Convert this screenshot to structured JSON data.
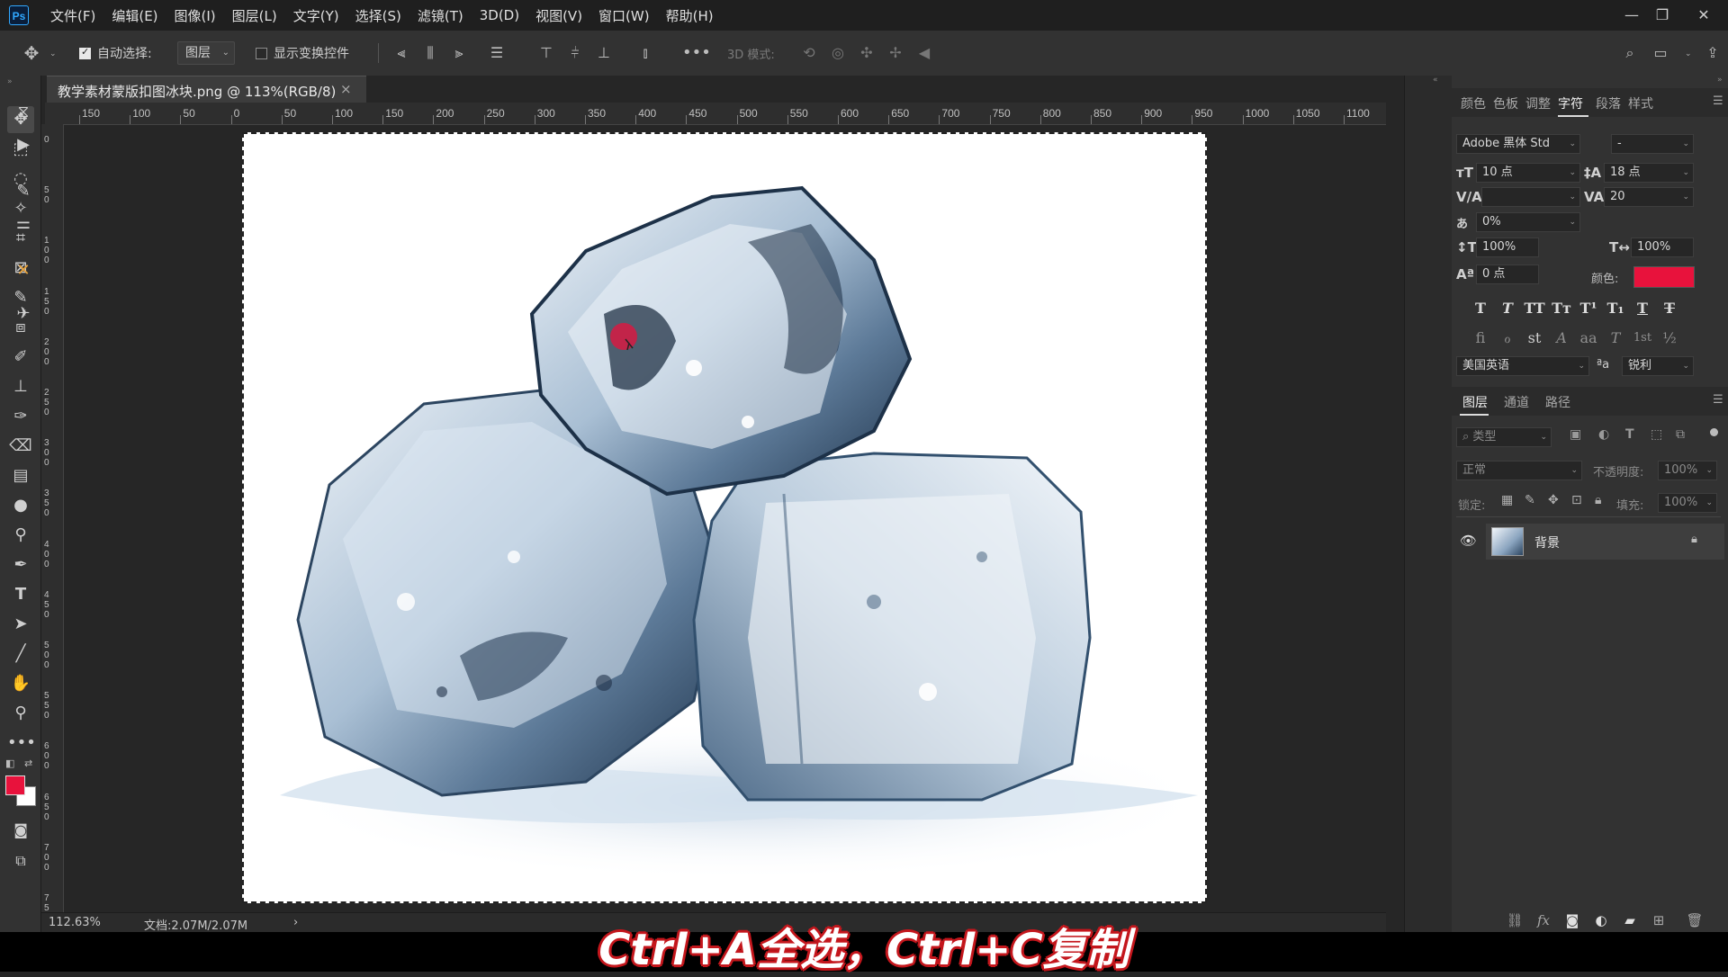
{
  "app": {
    "logo": "Ps"
  },
  "menu": [
    "文件(F)",
    "编辑(E)",
    "图像(I)",
    "图层(L)",
    "文字(Y)",
    "选择(S)",
    "滤镜(T)",
    "3D(D)",
    "视图(V)",
    "窗口(W)",
    "帮助(H)"
  ],
  "options_bar": {
    "auto_select_label": "自动选择:",
    "auto_select_checked": true,
    "target_dropdown": "图层",
    "show_transform_label": "显示变换控件",
    "show_transform_checked": false,
    "mode_3d_label": "3D 模式:"
  },
  "document": {
    "tab_title": "教学素材蒙版扣图冰块.png @ 113%(RGB/8)",
    "close": "×",
    "zoom": "112.63%",
    "doc_size": "文档:2.07M/2.07M",
    "status_arrow": "›"
  },
  "rulers": {
    "h_labels": [
      "150",
      "100",
      "50",
      "0",
      "50",
      "100",
      "150",
      "200",
      "250",
      "300",
      "350",
      "400",
      "450",
      "500",
      "550",
      "600",
      "650",
      "700",
      "750",
      "800",
      "850",
      "900",
      "950",
      "1000",
      "1050",
      "1100"
    ],
    "v_labels": [
      "0",
      "50",
      "100",
      "150",
      "200",
      "250",
      "300",
      "350",
      "400",
      "450",
      "500",
      "550",
      "600",
      "650",
      "700",
      "750"
    ]
  },
  "character_panel": {
    "tabs": [
      "颜色",
      "色板",
      "调整",
      "字符",
      "段落",
      "样式"
    ],
    "active_tab": "字符",
    "font_family": "Adobe 黑体 Std",
    "font_style": "-",
    "font_size": "10 点",
    "leading": "18 点",
    "kerning": "",
    "tracking": "20",
    "tsume": "0%",
    "vertical_scale": "100%",
    "horizontal_scale": "100%",
    "baseline_shift": "0 点",
    "color_label": "颜色:",
    "text_color": "#e8123c",
    "language": "美国英语",
    "antialias_label": "ªa",
    "antialias": "锐利",
    "type_buttons": [
      "T",
      "T",
      "TT",
      "Tт",
      "T¹",
      "T₁",
      "T",
      "T"
    ],
    "ot_buttons": [
      "fi",
      "ℴ",
      "st",
      "A",
      "aa",
      "T",
      "1st",
      "½"
    ]
  },
  "layers_panel": {
    "tabs": [
      "图层",
      "通道",
      "路径"
    ],
    "active_tab": "图层",
    "filter_placeholder": "类型",
    "blend_mode": "正常",
    "opacity_label": "不透明度:",
    "opacity": "100%",
    "lock_label": "锁定:",
    "fill_label": "填充:",
    "fill": "100%",
    "layers": [
      {
        "name": "背景",
        "visible": true,
        "locked": true
      }
    ]
  },
  "subtitle": "Ctrl+A全选，Ctrl+C复制",
  "colors": {
    "foreground": "#e8123c",
    "background": "#ffffff",
    "accent": "#31a8ff"
  }
}
